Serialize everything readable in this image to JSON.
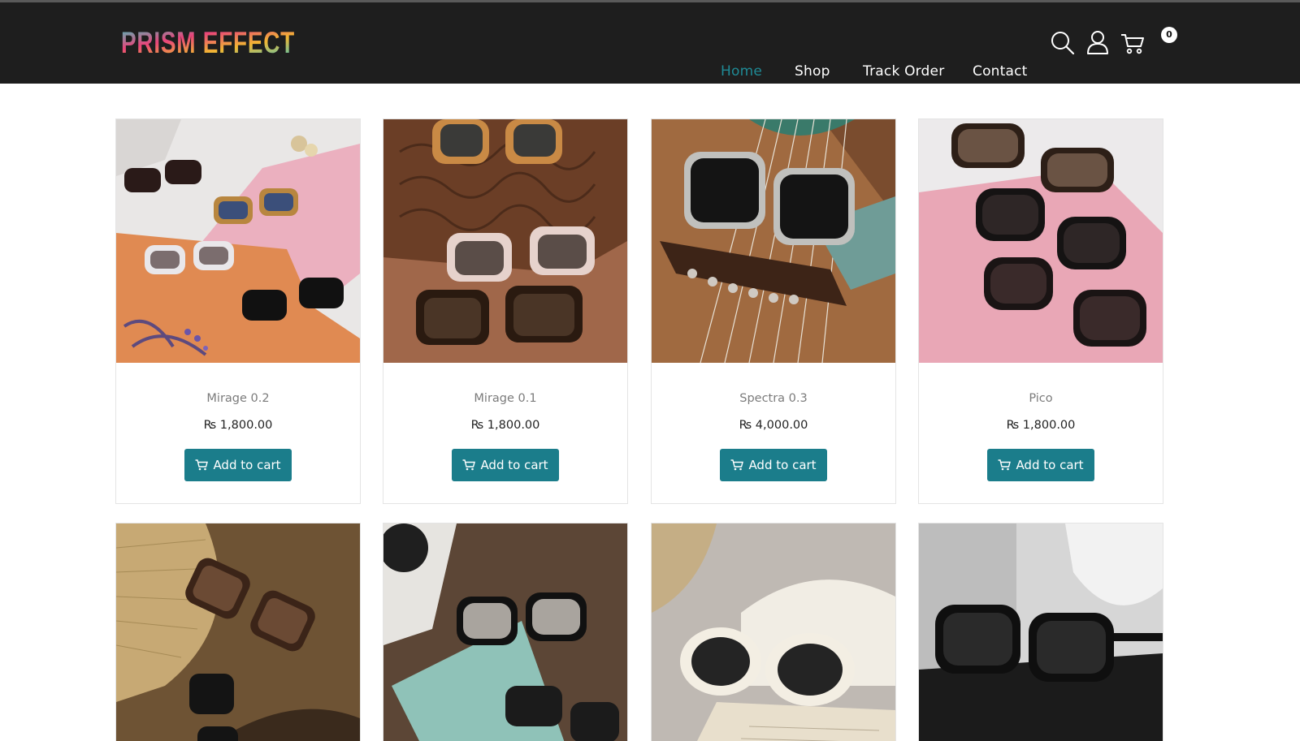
{
  "brand": {
    "name": "PRISM EFFECT"
  },
  "nav": {
    "items": [
      {
        "label": "Home",
        "active": true
      },
      {
        "label": "Shop",
        "active": false
      },
      {
        "label": "Track Order",
        "active": false
      },
      {
        "label": "Contact",
        "active": false
      }
    ],
    "icons": [
      "search-icon",
      "user-icon",
      "cart-icon"
    ],
    "cart_count": "0"
  },
  "colors": {
    "header_bg": "#1e1e1e",
    "accent": "#1b7d8b",
    "active_nav": "#1f8a95"
  },
  "products": [
    {
      "name": "Mirage 0.2",
      "price": "₨ 1,800.00",
      "button": "Add to cart"
    },
    {
      "name": "Mirage 0.1",
      "price": "₨ 1,800.00",
      "button": "Add to cart"
    },
    {
      "name": "Spectra 0.3",
      "price": "₨ 4,000.00",
      "button": "Add to cart"
    },
    {
      "name": "Pico",
      "price": "₨ 1,800.00",
      "button": "Add to cart"
    },
    {
      "name": "",
      "price": "",
      "button": ""
    },
    {
      "name": "",
      "price": "",
      "button": ""
    },
    {
      "name": "",
      "price": "",
      "button": ""
    },
    {
      "name": "",
      "price": "",
      "button": ""
    }
  ]
}
